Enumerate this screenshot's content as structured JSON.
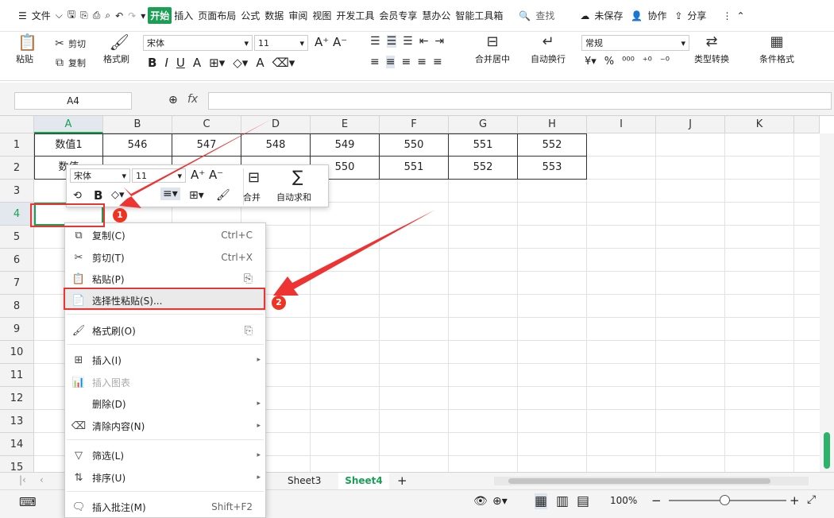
{
  "menubar": {
    "file": "文件",
    "tabs": [
      "开始",
      "插入",
      "页面布局",
      "公式",
      "数据",
      "审阅",
      "视图",
      "开发工具",
      "会员专享",
      "慧办公",
      "智能工具箱"
    ],
    "search": "查找",
    "unsaved": "未保存",
    "collab": "协作",
    "share": "分享"
  },
  "ribbon": {
    "paste": "粘贴",
    "cut": "剪切",
    "copy": "复制",
    "format_painter": "格式刷",
    "font": "宋体",
    "size": "11",
    "merge": "合并居中",
    "wrap": "自动换行",
    "numfmt": "常规",
    "convert": "类型转换",
    "cond": "条件格式",
    "bold": "B",
    "italic": "I",
    "underline": "U",
    "strike": "A",
    "fontcolor": "A"
  },
  "formula": {
    "namebox": "A4",
    "fx": "fx"
  },
  "columns": [
    "A",
    "B",
    "C",
    "D",
    "E",
    "F",
    "G",
    "H",
    "I",
    "J",
    "K"
  ],
  "rows": [
    "1",
    "2",
    "3",
    "4",
    "5",
    "6",
    "7",
    "8",
    "9",
    "10",
    "11",
    "12",
    "13",
    "14",
    "15"
  ],
  "cells": {
    "r1": [
      "数值1",
      "546",
      "547",
      "548",
      "549",
      "550",
      "551",
      "552"
    ],
    "r2": [
      "数值",
      "",
      "",
      "",
      "550",
      "551",
      "552",
      "553"
    ]
  },
  "mini": {
    "font": "宋体",
    "size": "11",
    "merge": "合并",
    "autosum": "自动求和",
    "bold": "B"
  },
  "context_menu": [
    {
      "icon": "copy-icon",
      "label": "复制(C)",
      "shortcut": "Ctrl+C"
    },
    {
      "icon": "cut-icon",
      "label": "剪切(T)",
      "shortcut": "Ctrl+X"
    },
    {
      "icon": "paste-icon",
      "label": "粘贴(P)",
      "shortcut": ""
    },
    {
      "icon": "paste-special-icon",
      "label": "选择性粘贴(S)...",
      "shortcut": ""
    },
    {
      "icon": "format-painter-icon",
      "label": "格式刷(O)",
      "shortcut": ""
    },
    {
      "icon": "insert-icon",
      "label": "插入(I)",
      "shortcut": ""
    },
    {
      "icon": "chart-icon",
      "label": "插入图表",
      "shortcut": ""
    },
    {
      "icon": "delete-icon",
      "label": "删除(D)",
      "shortcut": ""
    },
    {
      "icon": "clear-icon",
      "label": "清除内容(N)",
      "shortcut": ""
    },
    {
      "icon": "filter-icon",
      "label": "筛选(L)",
      "shortcut": ""
    },
    {
      "icon": "sort-icon",
      "label": "排序(U)",
      "shortcut": ""
    },
    {
      "icon": "comment-icon",
      "label": "插入批注(M)",
      "shortcut": "Shift+F2"
    }
  ],
  "sheets": [
    "Sheet3",
    "Sheet4"
  ],
  "status": {
    "zoom": "100%"
  },
  "annotations": [
    "1",
    "2"
  ]
}
